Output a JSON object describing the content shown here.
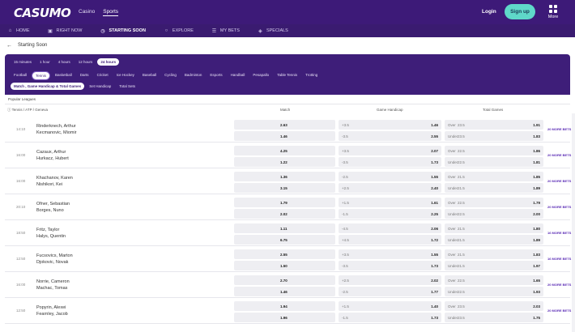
{
  "brand": {
    "logo": "CASUMO"
  },
  "topnav": {
    "casino": "Casino",
    "sports": "Sports"
  },
  "header": {
    "login": "Login",
    "signup": "Sign up",
    "more": "More"
  },
  "navbar": [
    {
      "icon": "home-icon",
      "label": "HOME"
    },
    {
      "icon": "tv-icon",
      "label": "RIGHT NOW"
    },
    {
      "icon": "clock-icon",
      "label": "STARTING SOON"
    },
    {
      "icon": "search-icon",
      "label": "EXPLORE"
    },
    {
      "icon": "bets-icon",
      "label": "MY BETS"
    },
    {
      "icon": "tag-icon",
      "label": "SPECIALS"
    }
  ],
  "page": {
    "title": "Starting Soon"
  },
  "time_filters": [
    "15 minutes",
    "1 hour",
    "4 hours",
    "12 hours",
    "24 hours"
  ],
  "sports": [
    "Football",
    "Tennis",
    "Basketball",
    "Darts",
    "Cricket",
    "Ice Hockey",
    "Baseball",
    "Cycling",
    "Badminton",
    "Esports",
    "Handball",
    "Pesapallo",
    "Table Tennis",
    "Trotting"
  ],
  "market_filters": [
    "Match , Game Handicap & Total Games",
    "Set Handicap",
    "Total Sets"
  ],
  "section": {
    "label": "Popular Leagues"
  },
  "columns": {
    "league": "Tennis / ATP / Geneva",
    "match": "Match",
    "handicap": "Game Handicap",
    "total": "Total Games"
  },
  "matches": [
    {
      "time": "14:10",
      "p1": "Rinderknech, Arthur",
      "p2": "Kecmanovic, Miomir",
      "m1": "2.63",
      "m2": "1.46",
      "h1l": "+3.5",
      "h1v": "1.46",
      "h2l": "-3.5",
      "h2v": "2.55",
      "t1l": "Over",
      "t1n": "23.5",
      "t1v": "1.91",
      "t2l": "Under",
      "t2n": "23.5",
      "t2v": "1.83",
      "more": "20 MORE BETS"
    },
    {
      "time": "16:00",
      "p1": "Cazaux, Arthur",
      "p2": "Hurkacz, Hubert",
      "m1": "4.25",
      "m2": "1.22",
      "h1l": "+3.5",
      "h1v": "2.07",
      "h2l": "-3.5",
      "h2v": "1.73",
      "t1l": "Over",
      "t1n": "22.5",
      "t1v": "1.86",
      "t2l": "Under",
      "t2n": "22.5",
      "t2v": "1.81",
      "more": "20 MORE BETS"
    },
    {
      "time": "16:00",
      "p1": "Khachanov, Karen",
      "p2": "Nishikori, Kei",
      "m1": "1.36",
      "m2": "3.15",
      "h1l": "-2.5",
      "h1v": "1.55",
      "h2l": "+2.5",
      "h2v": "2.40",
      "t1l": "Over",
      "t1n": "21.5",
      "t1v": "1.85",
      "t2l": "Under",
      "t2n": "21.5",
      "t2v": "1.89",
      "more": "20 MORE BETS"
    },
    {
      "time": "20:10",
      "p1": "Ofner, Sebastian",
      "p2": "Borges, Nuno",
      "m1": "1.79",
      "m2": "2.02",
      "h1l": "+1.5",
      "h1v": "1.61",
      "h2l": "-1.5",
      "h2v": "2.25",
      "t1l": "Over",
      "t1n": "22.5",
      "t1v": "1.79",
      "t2l": "Under",
      "t2n": "22.5",
      "t2v": "2.00",
      "more": "20 MORE BETS"
    },
    {
      "time": "18:50",
      "p1": "Fritz, Taylor",
      "p2": "Halys, Quentin",
      "m1": "1.11",
      "m2": "6.75",
      "h1l": "-4.5",
      "h1v": "2.06",
      "h2l": "+4.5",
      "h2v": "1.72",
      "t1l": "Over",
      "t1n": "21.5",
      "t1v": "1.80",
      "t2l": "Under",
      "t2n": "21.5",
      "t2v": "1.89",
      "more": "16 MORE BETS"
    },
    {
      "time": "12:50",
      "p1": "Fucsovics, Marton",
      "p2": "Djokovic, Novak",
      "m1": "2.55",
      "m2": "1.50",
      "h1l": "+3.5",
      "h1v": "1.55",
      "h2l": "-3.5",
      "h2v": "1.73",
      "t1l": "Over",
      "t1n": "21.5",
      "t1v": "1.83",
      "t2l": "Under",
      "t2n": "21.5",
      "t2v": "1.97",
      "more": "16 MORE BETS"
    },
    {
      "time": "16:00",
      "p1": "Norrie, Cameron",
      "p2": "Machac, Tomas",
      "m1": "2.70",
      "m2": "1.46",
      "h1l": "+2.5",
      "h1v": "2.02",
      "h2l": "-2.5",
      "h2v": "1.77",
      "t1l": "Over",
      "t1n": "22.5",
      "t1v": "1.65",
      "t2l": "Under",
      "t2n": "22.5",
      "t2v": "1.93",
      "more": "20 MORE BETS"
    },
    {
      "time": "12:50",
      "p1": "Popyrin, Alexei",
      "p2": "Fearnley, Jacob",
      "m1": "1.94",
      "m2": "1.96",
      "h1l": "+1.5",
      "h1v": "1.40",
      "h2l": "-1.5",
      "h2v": "1.73",
      "t1l": "Over",
      "t1n": "23.5",
      "t1v": "2.03",
      "t2l": "Under",
      "t2n": "23.5",
      "t2v": "1.75",
      "more": "20 MORE BETS"
    }
  ],
  "colors": {
    "brand_purple": "#3d1a78",
    "signup_teal": "#5fd8c9",
    "more_bets": "#5a2bb5"
  }
}
